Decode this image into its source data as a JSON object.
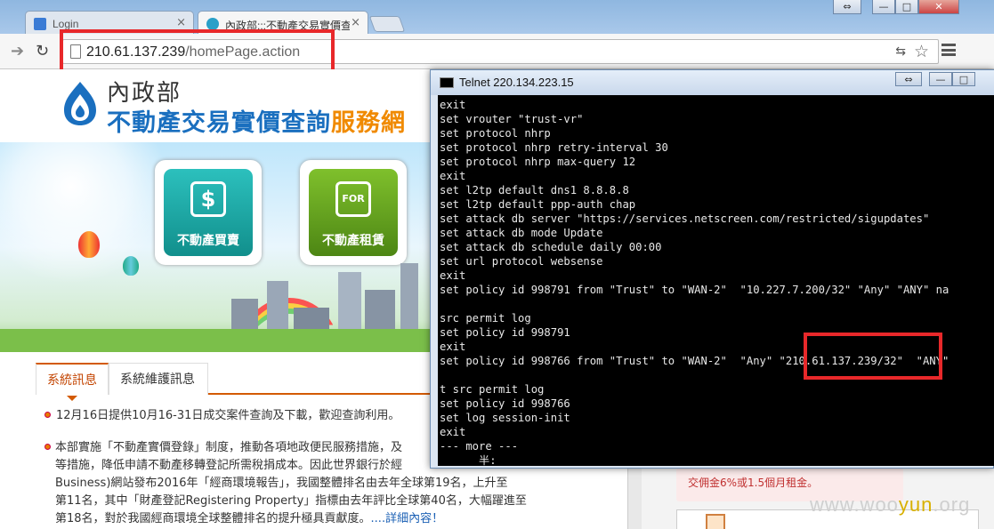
{
  "browser": {
    "tabs": [
      {
        "title": "Login",
        "close": "×"
      },
      {
        "title": "內政部:::不動產交易實價查",
        "close": "×"
      }
    ],
    "url_host": "210.61.137.239",
    "url_path": "/homePage.action",
    "window_controls": [
      "⇔",
      "—",
      "□",
      "✕"
    ]
  },
  "page": {
    "brand_top": "內政部",
    "brand_main": "不動產交易實價查詢",
    "brand_suffix": "服務網",
    "tiles": [
      {
        "label": "不動產買賣",
        "color": "#1aa3a0",
        "icon": "house-dollar-icon"
      },
      {
        "label": "不動產租賃",
        "color": "#5e9d1c",
        "icon": "for-rent-icon"
      }
    ],
    "news_tabs": [
      "系統訊息",
      "系統維護訊息"
    ],
    "news1": "12月16日提供10月16-31日成交案件查詢及下載，歡迎查詢利用。",
    "news2_lines": [
      "本部實施「不動產實價登錄」制度，推動各項地政便民服務措施，及",
      "等措施，降低申請不動產移轉登記所需稅捐成本。因此世界銀行於經",
      "Business)網站發布2016年「經商環境報告」，我國整體排名由去年全球第19名，上升至",
      "第11名，其中「財產登記Registering Property」指標由去年評比全球第40名，大幅躍進至",
      "第18名，對於我國經商環境全球整體排名的提升極具貢獻度。"
    ],
    "more_link": "....詳細內容！",
    "rent_text": "交佣金6%或1.5個月租金。",
    "watermark_a": "www.woo",
    "watermark_b": "yun",
    "watermark_c": ".org"
  },
  "telnet": {
    "title": "Telnet 220.134.223.15",
    "controls": [
      "⇔",
      "—",
      "□"
    ],
    "lines": [
      "exit",
      "set vrouter \"trust-vr\"",
      "set protocol nhrp",
      "set protocol nhrp retry-interval 30",
      "set protocol nhrp max-query 12",
      "exit",
      "set l2tp default dns1 8.8.8.8",
      "set l2tp default ppp-auth chap",
      "set attack db server \"https://services.netscreen.com/restricted/sigupdates\"",
      "set attack db mode Update",
      "set attack db schedule daily 00:00",
      "set url protocol websense",
      "exit",
      "set policy id 998791 from \"Trust\" to \"WAN-2\"  \"10.227.7.200/32\" \"Any\" \"ANY\" na",
      "",
      "src permit log",
      "set policy id 998791",
      "exit",
      "set policy id 998766 from \"Trust\" to \"WAN-2\"  \"Any\" \"210.61.137.239/32\"  \"ANY\"",
      "",
      "t src permit log",
      "set policy id 998766",
      "set log session-init",
      "exit",
      "--- more ---",
      "      半:"
    ]
  },
  "colors": {
    "highlight": "#e8282a",
    "terminal_bg": "#000000",
    "brand_blue": "#1a6fbf",
    "brand_orange": "#f08a00"
  }
}
